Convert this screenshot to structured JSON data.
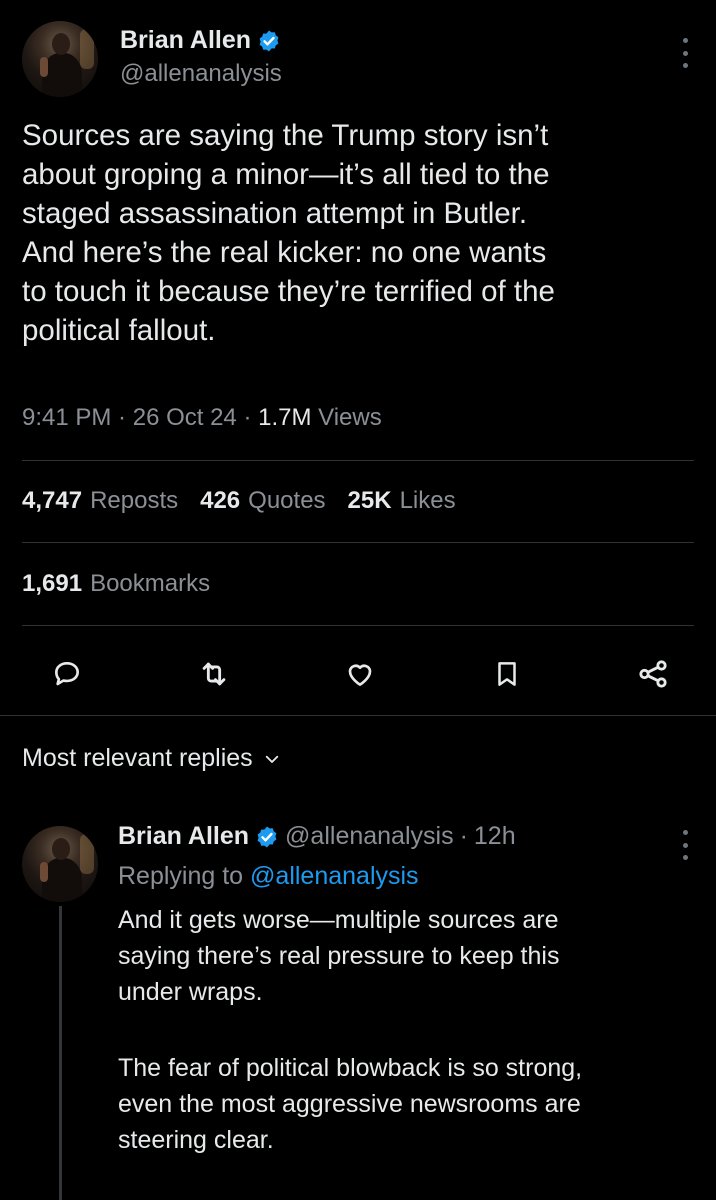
{
  "post": {
    "author_name": "Brian Allen",
    "handle": "@allenanalysis",
    "text": "Sources are saying the Trump story isn’t\nabout groping a minor—it’s all tied to the\nstaged assassination attempt in Butler.\nAnd here’s the real kicker: no one wants\nto touch it because they’re terrified of the\npolitical fallout.",
    "time": "9:41 PM",
    "date": "26 Oct 24",
    "views_count": "1.7M",
    "views_label": "Views",
    "stats": {
      "reposts_count": "4,747",
      "reposts_label": "Reposts",
      "quotes_count": "426",
      "quotes_label": "Quotes",
      "likes_count": "25K",
      "likes_label": "Likes",
      "bookmarks_count": "1,691",
      "bookmarks_label": "Bookmarks"
    },
    "actions": [
      "reply-icon",
      "repost-icon",
      "like-icon",
      "bookmark-icon",
      "share-icon"
    ]
  },
  "replies_header": "Most relevant replies",
  "reply": {
    "author_name": "Brian Allen",
    "handle": "@allenanalysis",
    "time_ago": "12h",
    "replying_prefix": "Replying to",
    "replying_to": "@allenanalysis",
    "paragraph_1": "And it gets worse—multiple sources are\nsaying there’s real pressure to keep this\nunder wraps.",
    "paragraph_2": "The fear of political blowback is so strong,\neven the most aggressive newsrooms are\nsteering clear."
  },
  "colors": {
    "background": "#000000",
    "text": "#e7e9ea",
    "secondary_text": "#8b9096",
    "link": "#1d9bf0",
    "verified": "#1d9bf0",
    "divider": "#2f3336"
  }
}
